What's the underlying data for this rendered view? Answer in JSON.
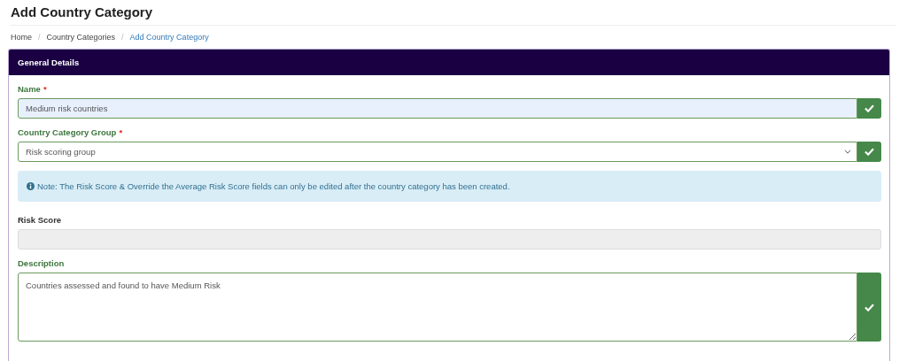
{
  "page": {
    "title": "Add Country Category"
  },
  "breadcrumb": [
    {
      "label": "Home",
      "current": false
    },
    {
      "separator": "/",
      "label": "Country Categories",
      "current": false
    },
    {
      "separator": "/",
      "label": "Add Country Category",
      "current": true
    }
  ],
  "panel": {
    "title": "General Details",
    "items": [
      {
        "kind": "text",
        "label": "Name",
        "required_mark": "*",
        "value": "Medium risk countries",
        "valid": true
      },
      {
        "kind": "select",
        "label": "Country Category Group",
        "required_mark": "*",
        "value": "Risk scoring group",
        "valid": true
      },
      {
        "kind": "note",
        "text": "Note: The Risk Score & Override the Average Risk Score fields can only be edited after the country category has been created."
      },
      {
        "kind": "text",
        "label": "Risk Score",
        "disabled": true,
        "valid": false
      },
      {
        "kind": "textarea",
        "label": "Description",
        "value": "Countries assessed and found to have Medium Risk",
        "valid": true
      }
    ]
  }
}
